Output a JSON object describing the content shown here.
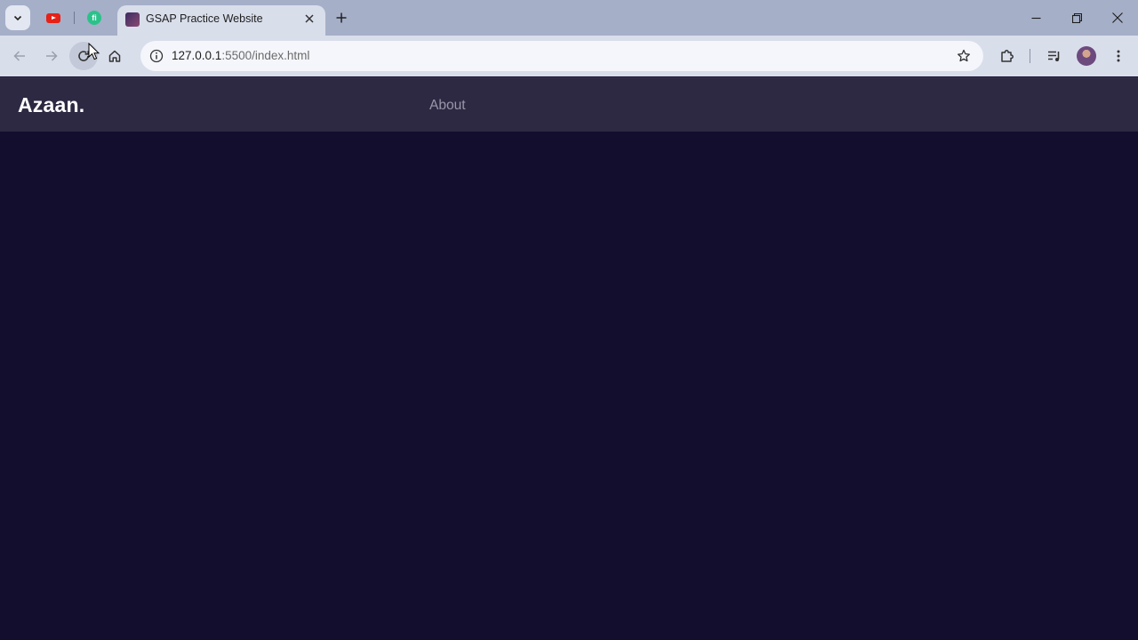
{
  "browser": {
    "pinned_tabs": [
      {
        "name": "youtube",
        "icon": "youtube-icon"
      },
      {
        "name": "fi-app",
        "icon": "fi-icon",
        "label": "fi"
      }
    ],
    "active_tab": {
      "title": "GSAP Practice Website"
    },
    "address_bar": {
      "host": "127.0.0.1",
      "rest": ":5500/index.html"
    }
  },
  "site": {
    "brand": "Azaan.",
    "nav": {
      "about": "About"
    },
    "colors": {
      "background": "#130e2e",
      "navbar": "#2d2943",
      "link": "#9a97aa"
    }
  }
}
